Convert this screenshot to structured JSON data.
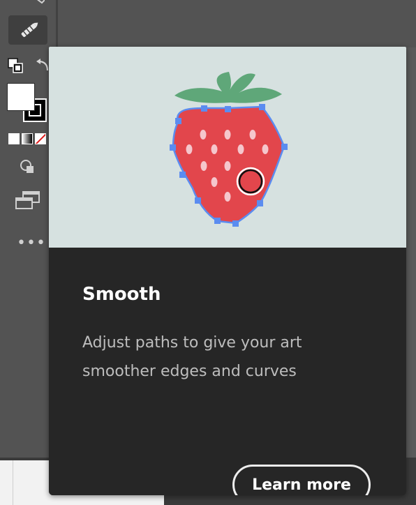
{
  "popup": {
    "title": "Smooth",
    "description": "Adjust paths to give your art smoother edges and curves",
    "learn_more_label": "Learn more"
  },
  "toolbar": {
    "active_tool_icon": "smooth-tool-icon",
    "fill_color": "#ffffff",
    "stroke_color": "#000000",
    "more_label": "•••"
  },
  "colors": {
    "popup_image_bg": "#d6e1e0",
    "popup_body_bg": "#262626",
    "strawberry_red": "#e2464c",
    "leaf_green": "#5fa779",
    "path_blue": "#5b8cf0",
    "toolbar_bg": "#535353"
  }
}
